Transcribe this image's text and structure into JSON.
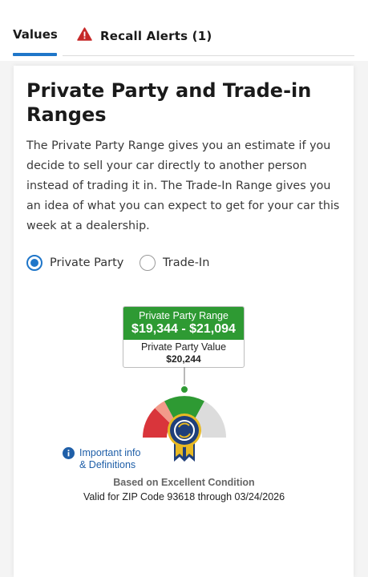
{
  "tabs": {
    "values_label": "Values",
    "recall_label": "Recall Alerts (1)"
  },
  "section": {
    "title": "Private Party and Trade-in Ranges",
    "description": "The Private Party Range gives you an estimate if you decide to sell your car directly to another person instead of trading it in. The Trade-In Range gives you an idea of what you can expect to get for your car this week at a dealership."
  },
  "options": {
    "private_party": "Private Party",
    "trade_in": "Trade-In",
    "selected": "Private Party"
  },
  "range": {
    "title": "Private Party Range",
    "value": "$19,344 - $21,094",
    "value_title": "Private Party Value",
    "value_amount": "$20,244"
  },
  "info": {
    "line1": "Important info",
    "line2": "& Definitions"
  },
  "footer": {
    "condition": "Based on Excellent Condition",
    "valid": "Valid for ZIP Code 93618 through 03/24/2026"
  },
  "colors": {
    "accent_blue": "#1f76c9",
    "range_green": "#2e9a33",
    "gauge_red": "#d9353b",
    "alert_red": "#c62828"
  },
  "icons": {
    "recall": "warning-triangle-icon",
    "info": "info-circle-icon",
    "gauge": "value-gauge-ribbon-icon"
  }
}
